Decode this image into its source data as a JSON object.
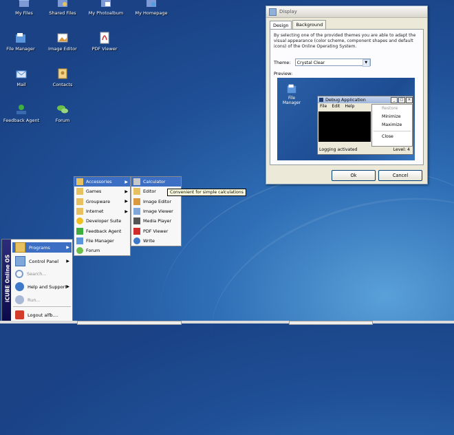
{
  "desktop_icons": [
    {
      "label": "My Files",
      "icon": "home-folder-icon",
      "color": "#6d8bc9"
    },
    {
      "label": "Shared Files",
      "icon": "shared-folder-icon",
      "color": "#6d8bc9"
    },
    {
      "label": "My Photoalbum",
      "icon": "photo-folder-icon",
      "color": "#6d8bc9"
    },
    {
      "label": "My Homepage",
      "icon": "homepage-folder-icon",
      "color": "#6d8bc9"
    },
    {
      "label": "File Manager",
      "icon": "file-manager-icon",
      "color": "#4f8fd9"
    },
    {
      "label": "Image Editor",
      "icon": "image-editor-icon",
      "color": "#d99a3f"
    },
    {
      "label": "PDF Viewer",
      "icon": "pdf-icon",
      "color": "#d12b2b"
    },
    {
      "label": "Mail",
      "icon": "mail-icon",
      "color": "#4f8fd9"
    },
    {
      "label": "Contacts",
      "icon": "contacts-icon",
      "color": "#e0a040"
    },
    {
      "label": "Feedback Agent",
      "icon": "feedback-icon",
      "color": "#3fae3f"
    },
    {
      "label": "Forum",
      "icon": "forum-icon",
      "color": "#6cc04a"
    }
  ],
  "display_window": {
    "title": "Display",
    "tabs": [
      "Design",
      "Background"
    ],
    "description": "By selecting one of the provided themes you are able to adapt the visual appearance (color scheme, component shapes and default icons) of the Online Operating System.",
    "theme_label": "Theme:",
    "theme_value": "Crystal Clear",
    "preview_label": "Preview:",
    "preview_icon_label": "File Manager",
    "debug": {
      "title": "Debug Application",
      "menu": [
        "File",
        "Edit",
        "Help"
      ],
      "context": [
        "Restore",
        "Minimize",
        "Maximize",
        "Close"
      ],
      "status_left": "Logging activated",
      "status_right": "Level: 4"
    },
    "ok_label": "Ok",
    "cancel_label": "Cancel"
  },
  "start_menu": {
    "side_label": "iCUBE Online OS",
    "items": [
      {
        "label": "Programs",
        "icon": "programs-icon",
        "arrow": "▶"
      },
      {
        "label": "Control Panel",
        "icon": "control-panel-icon",
        "arrow": "▶"
      },
      {
        "label": "Search...",
        "icon": "search-icon",
        "arrow": ""
      },
      {
        "label": "Help and Support",
        "icon": "help-icon",
        "arrow": "▶"
      },
      {
        "label": "Run...",
        "icon": "run-icon",
        "arrow": ""
      },
      {
        "label": "Logout alfb....",
        "icon": "logout-icon",
        "arrow": ""
      }
    ]
  },
  "programs_menu": [
    {
      "label": "Accessories",
      "arrow": "▶"
    },
    {
      "label": "Games",
      "arrow": "▶"
    },
    {
      "label": "Groupware",
      "arrow": "▶"
    },
    {
      "label": "Internet",
      "arrow": "▶"
    },
    {
      "label": "Developer Suite",
      "arrow": ""
    },
    {
      "label": "Feedback Agent",
      "arrow": ""
    },
    {
      "label": "File Manager",
      "arrow": ""
    },
    {
      "label": "Forum",
      "arrow": ""
    }
  ],
  "accessories_menu": [
    "Calculator",
    "Editor",
    "Image Editor",
    "Image Viewer",
    "Media Player",
    "PDF Viewer",
    "Write"
  ],
  "tooltip": "Convenient for simple calculations"
}
